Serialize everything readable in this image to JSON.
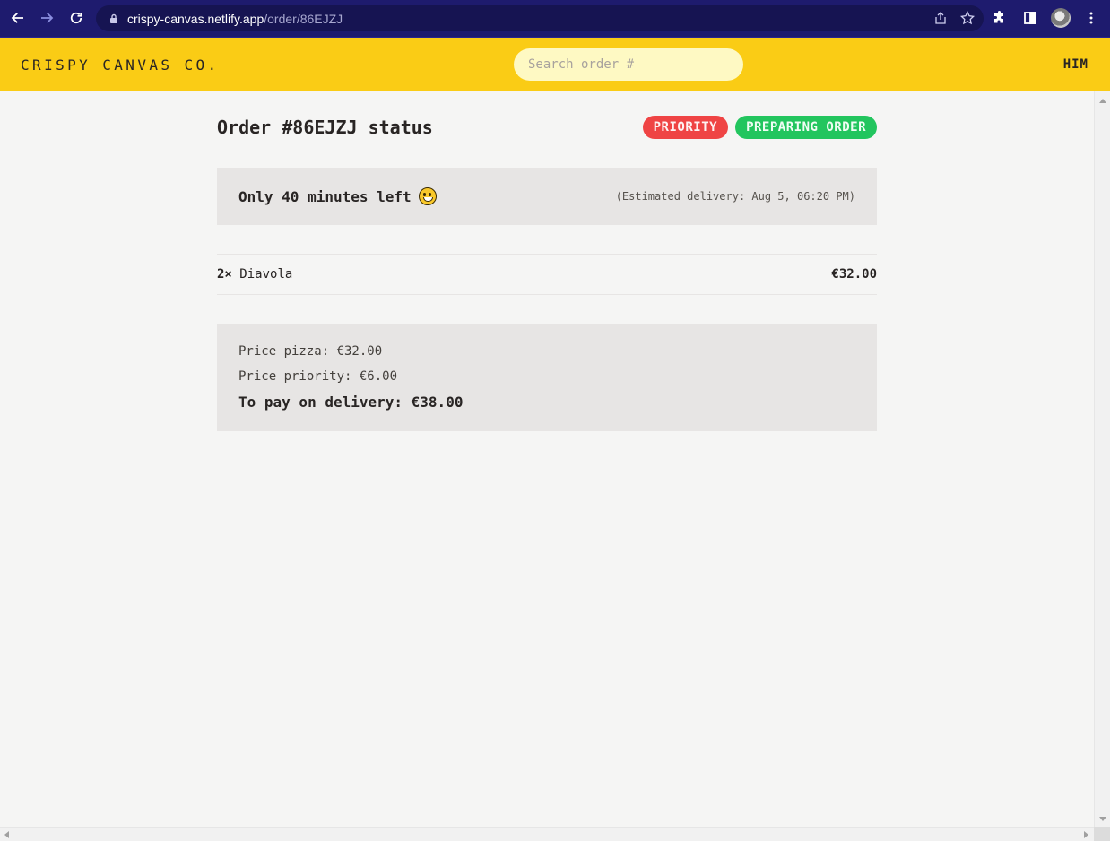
{
  "browser": {
    "url_host": "crispy-canvas.netlify.app",
    "url_path": "/order/86EJZJ"
  },
  "header": {
    "logo": "CRISPY CANVAS CO.",
    "search_placeholder": "Search order #",
    "search_value": "",
    "username": "HIM"
  },
  "order": {
    "title": "Order #86EJZJ status",
    "badges": {
      "priority": "PRIORITY",
      "status": "PREPARING ORDER"
    },
    "eta_text": "Only 40 minutes left",
    "eta_emoji": "grinning-face-emoji",
    "estimated_delivery": "(Estimated delivery: Aug 5, 06:20 PM)",
    "items": [
      {
        "quantity": "2×",
        "name": "Diavola",
        "price": "€32.00"
      }
    ],
    "summary": {
      "price_pizza": "Price pizza: €32.00",
      "price_priority": "Price priority: €6.00",
      "to_pay": "To pay on delivery: €38.00"
    }
  },
  "colors": {
    "header_bg": "#facc15",
    "priority_badge": "#ef4444",
    "status_badge": "#22c55e",
    "panel_bg": "#e7e5e4",
    "page_bg": "#f5f5f4"
  }
}
